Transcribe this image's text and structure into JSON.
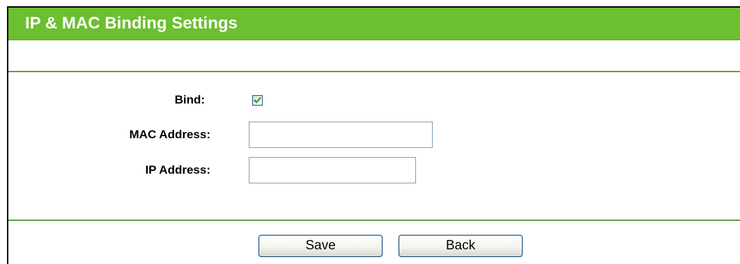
{
  "header": {
    "title": "IP & MAC Binding Settings"
  },
  "form": {
    "bind_label": "Bind:",
    "bind_checked": true,
    "mac_label": "MAC Address:",
    "mac_value": "",
    "ip_label": "IP Address:",
    "ip_value": ""
  },
  "buttons": {
    "save_label": "Save",
    "back_label": "Back"
  },
  "colors": {
    "title_bar": "#6cbf2f",
    "divider": "#5a9e45",
    "checkmark": "#21a121"
  },
  "icons": {
    "bind_checkbox": "checkmark-icon"
  }
}
